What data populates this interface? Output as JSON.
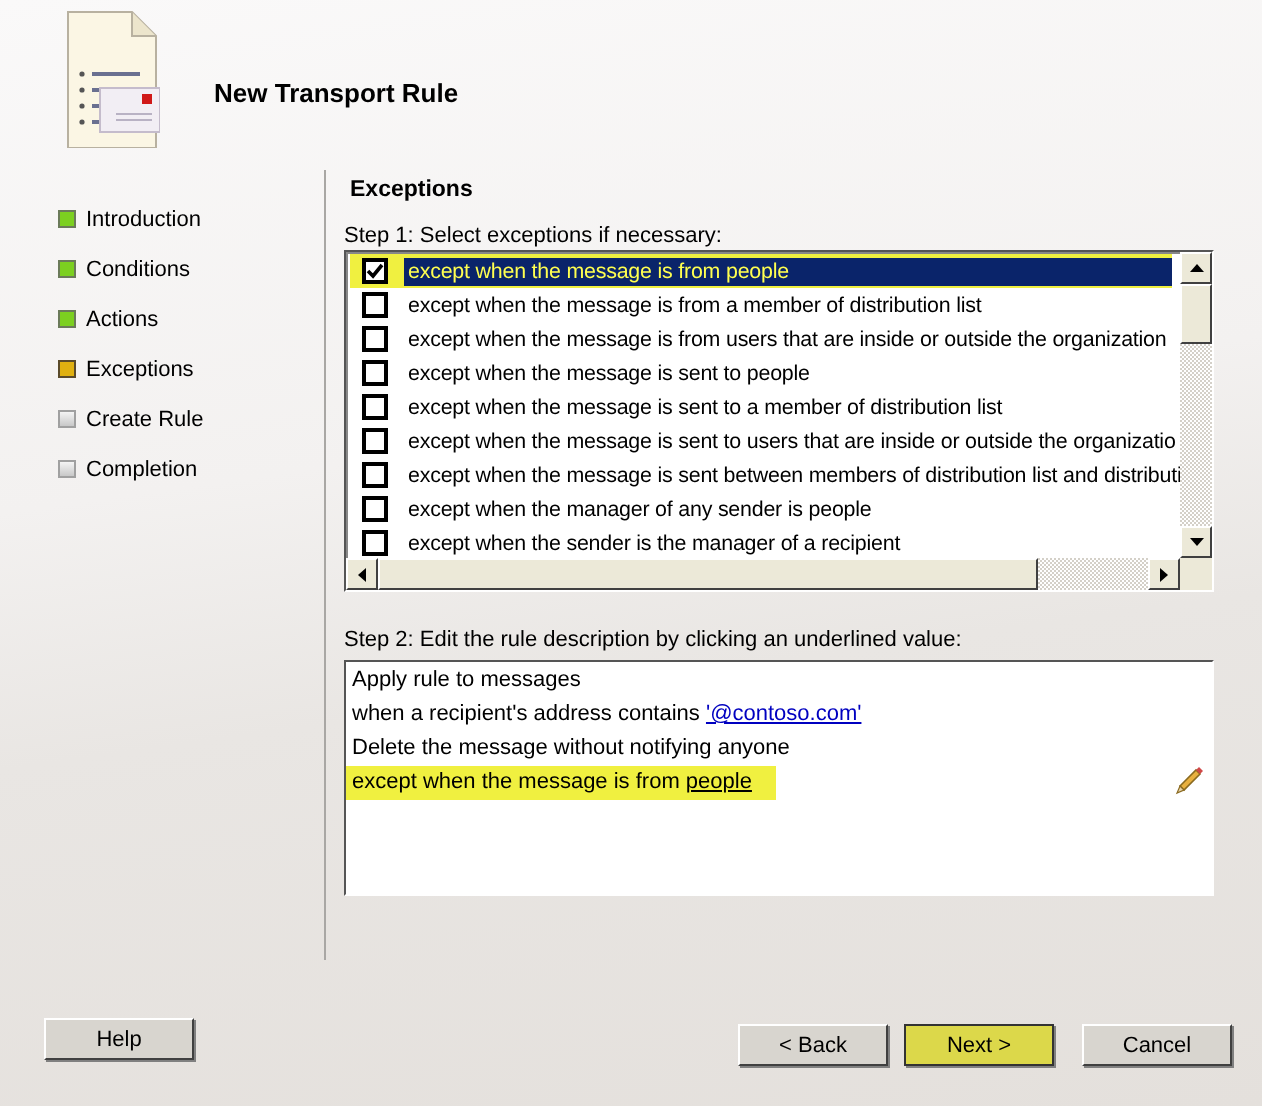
{
  "wizard": {
    "title": "New Transport Rule"
  },
  "steps": [
    {
      "label": "Introduction",
      "completed": true,
      "current": false
    },
    {
      "label": "Conditions",
      "completed": true,
      "current": false
    },
    {
      "label": "Actions",
      "completed": true,
      "current": false
    },
    {
      "label": "Exceptions",
      "completed": false,
      "current": true
    },
    {
      "label": "Create Rule",
      "completed": false,
      "current": false
    },
    {
      "label": "Completion",
      "completed": false,
      "current": false
    }
  ],
  "page": {
    "heading": "Exceptions",
    "step1_label": "Step 1: Select exceptions if necessary:",
    "step2_label": "Step 2: Edit the rule description by clicking an underlined value:"
  },
  "exceptions": [
    {
      "label": "except when the message is from people",
      "checked": true,
      "selected": true,
      "highlighted": true
    },
    {
      "label": "except when the message is from a member of distribution list",
      "checked": false,
      "selected": false,
      "highlighted": false
    },
    {
      "label": "except when the message is from users that are inside or outside the organization",
      "checked": false,
      "selected": false,
      "highlighted": false
    },
    {
      "label": "except when the message is sent to people",
      "checked": false,
      "selected": false,
      "highlighted": false
    },
    {
      "label": "except when the message is sent to a member of distribution list",
      "checked": false,
      "selected": false,
      "highlighted": false
    },
    {
      "label": "except when the message is sent to users that are inside or outside the organizatio",
      "checked": false,
      "selected": false,
      "highlighted": false
    },
    {
      "label": "except when the message is sent between members of distribution list and distributi",
      "checked": false,
      "selected": false,
      "highlighted": false
    },
    {
      "label": "except when the manager of any sender is people",
      "checked": false,
      "selected": false,
      "highlighted": false
    },
    {
      "label": "except when the sender is the manager of a recipient",
      "checked": false,
      "selected": false,
      "highlighted": false
    }
  ],
  "description": [
    {
      "highlighted": false,
      "parts": [
        {
          "kind": "text",
          "text": "Apply rule to messages"
        }
      ]
    },
    {
      "highlighted": false,
      "parts": [
        {
          "kind": "text",
          "text": "when a recipient's address contains"
        },
        {
          "kind": "link",
          "text": "'@contoso.com'"
        }
      ]
    },
    {
      "highlighted": false,
      "parts": [
        {
          "kind": "text",
          "text": "Delete the message without notifying anyone"
        }
      ]
    },
    {
      "highlighted": true,
      "parts": [
        {
          "kind": "text",
          "text": "except when the message is from"
        },
        {
          "kind": "value",
          "text": "people"
        }
      ]
    }
  ],
  "buttons": [
    {
      "label": "Help",
      "highlighted": false
    },
    {
      "label": "< Back",
      "highlighted": false
    },
    {
      "label": "Next >",
      "highlighted": true
    },
    {
      "label": "Cancel",
      "highlighted": false
    }
  ]
}
